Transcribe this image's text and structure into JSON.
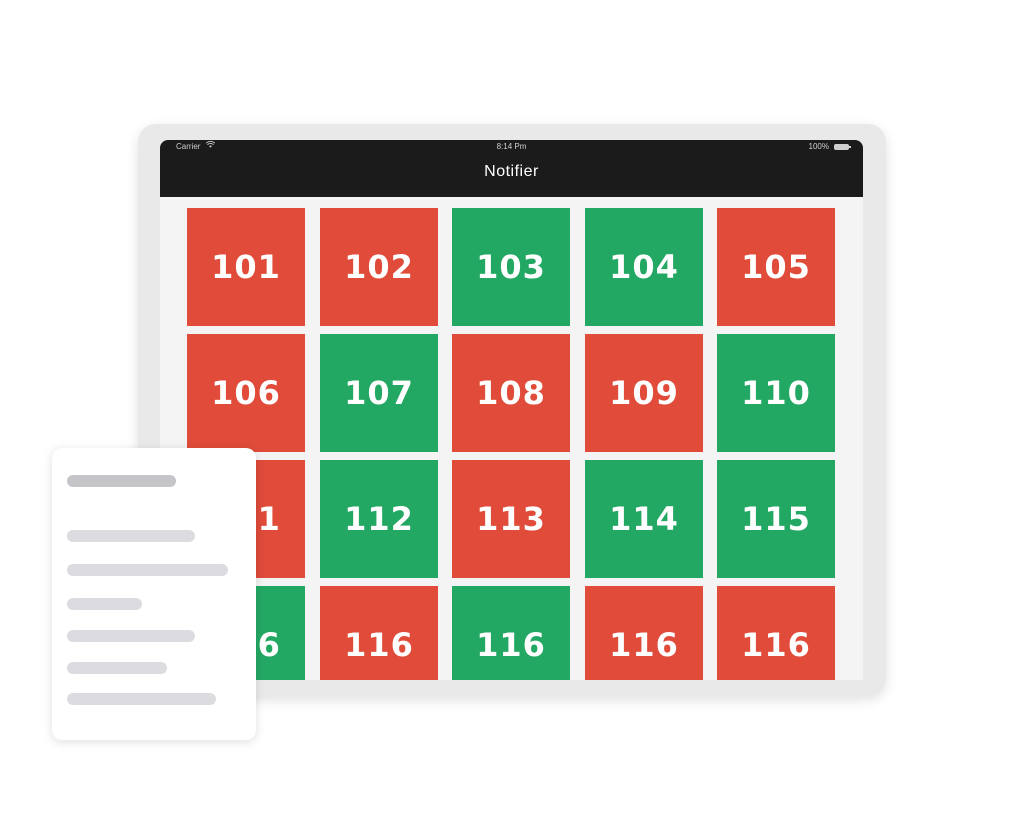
{
  "status_bar": {
    "carrier": "Carrier",
    "time": "8:14 Pm",
    "battery": "100%",
    "wifi_icon": "wifi-icon",
    "battery_icon": "battery-icon"
  },
  "nav": {
    "title": "Notifier"
  },
  "colors": {
    "red": "#e04b3a",
    "green": "#23a863",
    "nav_background": "#1b1b1b",
    "frame": "#e9e9ea"
  },
  "rooms": [
    {
      "label": "101",
      "status": "red"
    },
    {
      "label": "102",
      "status": "red"
    },
    {
      "label": "103",
      "status": "green"
    },
    {
      "label": "104",
      "status": "green"
    },
    {
      "label": "105",
      "status": "red"
    },
    {
      "label": "106",
      "status": "red"
    },
    {
      "label": "107",
      "status": "green"
    },
    {
      "label": "108",
      "status": "red"
    },
    {
      "label": "109",
      "status": "red"
    },
    {
      "label": "110",
      "status": "green"
    },
    {
      "label": "111",
      "status": "red"
    },
    {
      "label": "112",
      "status": "green"
    },
    {
      "label": "113",
      "status": "red"
    },
    {
      "label": "114",
      "status": "green"
    },
    {
      "label": "115",
      "status": "green"
    },
    {
      "label": "116",
      "status": "green"
    },
    {
      "label": "116",
      "status": "red"
    },
    {
      "label": "116",
      "status": "green"
    },
    {
      "label": "116",
      "status": "red"
    },
    {
      "label": "116",
      "status": "red"
    }
  ],
  "document_card": {
    "icon": "document-placeholder-icon"
  }
}
